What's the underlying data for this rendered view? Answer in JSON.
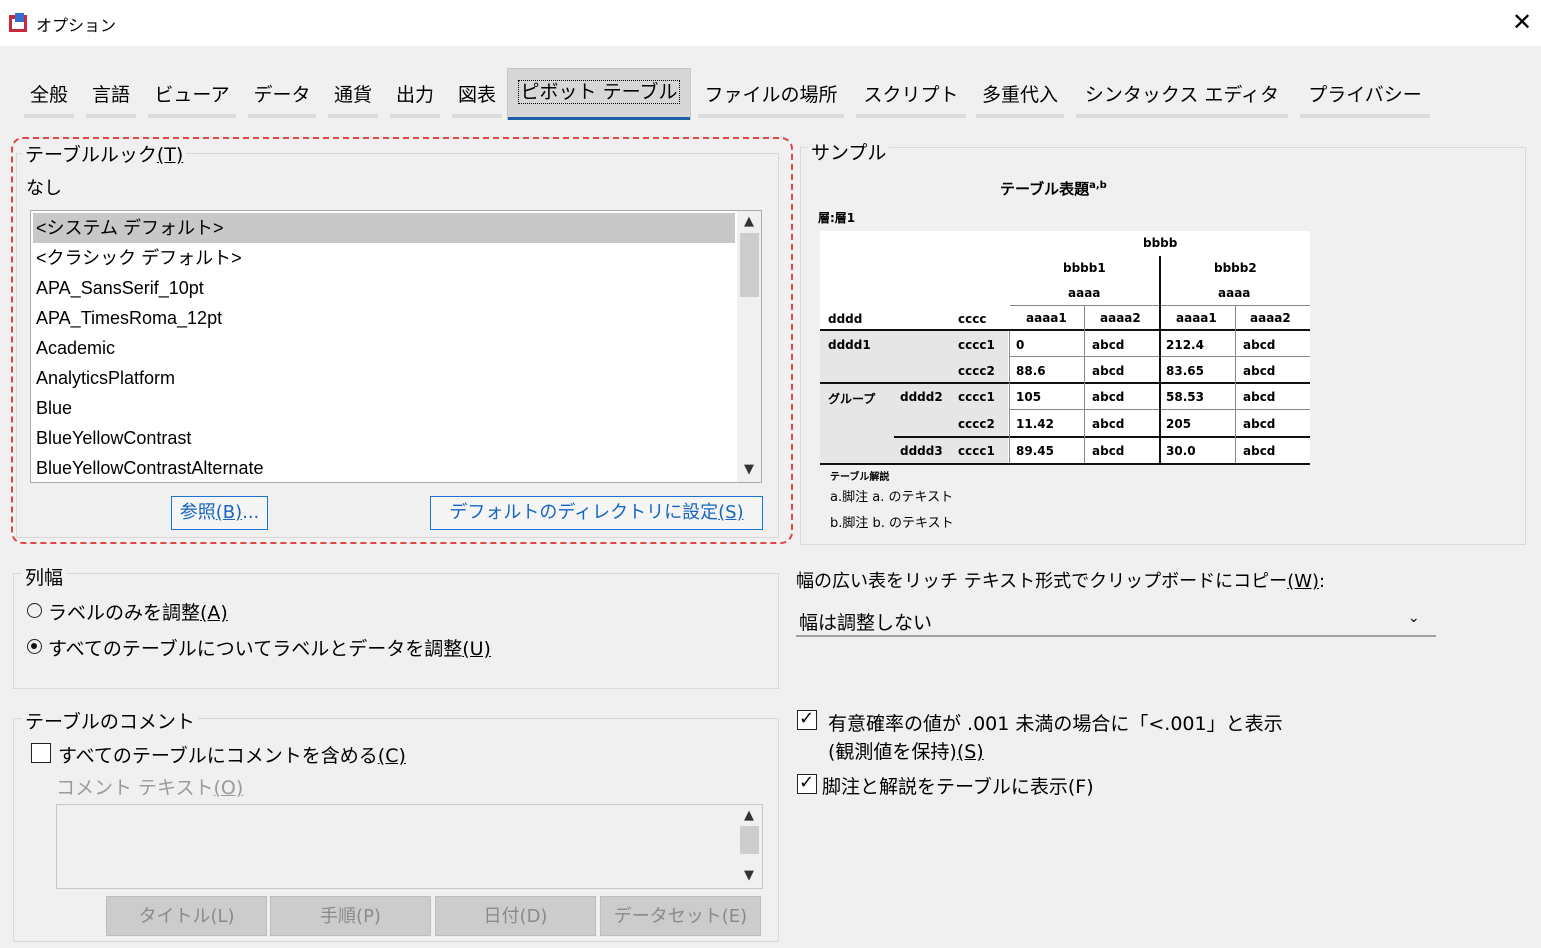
{
  "window": {
    "title": "オプション",
    "close_glyph": "✕"
  },
  "tabs": [
    {
      "label": "全般"
    },
    {
      "label": "言語"
    },
    {
      "label": "ビューア"
    },
    {
      "label": "データ"
    },
    {
      "label": "通貨"
    },
    {
      "label": "出力"
    },
    {
      "label": "図表"
    },
    {
      "label": "ピボット テーブル"
    },
    {
      "label": "ファイルの場所"
    },
    {
      "label": "スクリプト"
    },
    {
      "label": "多重代入"
    },
    {
      "label": "シンタックス エディタ"
    },
    {
      "label": "プライバシー"
    }
  ],
  "active_tab_index": 7,
  "table_looks": {
    "legend": "テーブルルック",
    "legend_key": "(T)",
    "current": "なし",
    "items": [
      "<システム デフォルト>",
      "<クラシック デフォルト>",
      "APA_SansSerif_10pt",
      "APA_TimesRoma_12pt",
      "Academic",
      "AnalyticsPlatform",
      "Blue",
      "BlueYellowContrast",
      "BlueYellowContrastAlternate"
    ],
    "selected_index": 0,
    "browse_button": "参照",
    "browse_key": "(B)",
    "browse_suffix": "...",
    "set_default_button": "デフォルトのディレクトリに設定",
    "set_default_key": "(S)"
  },
  "sample": {
    "legend": "サンプル",
    "table_title": "テーブル表題",
    "title_sup": "a,b",
    "layer": "層:層1",
    "col_top": "bbbb",
    "col_mid": [
      "bbbb1",
      "bbbb2"
    ],
    "col_sub": [
      "aaaa",
      "aaaa"
    ],
    "row_header_1": "dddd",
    "row_header_2": "cccc",
    "col_leaf": [
      "aaaa1",
      "aaaa2",
      "aaaa1",
      "aaaa2"
    ],
    "rows": [
      {
        "g": "",
        "d": "dddd1",
        "c": "cccc1",
        "v": [
          "0",
          "abcd",
          "212.4",
          "abcd"
        ]
      },
      {
        "g": "",
        "d": "",
        "c": "cccc2",
        "v": [
          "88.6",
          "abcd",
          "83.65",
          "abcd"
        ]
      },
      {
        "g": "グループ",
        "d": "dddd2",
        "c": "cccc1",
        "v": [
          "105",
          "abcd",
          "58.53",
          "abcd"
        ]
      },
      {
        "g": "",
        "d": "",
        "c": "cccc2",
        "v": [
          "11.42",
          "abcd",
          "205",
          "abcd"
        ]
      },
      {
        "g": "",
        "d": "dddd3",
        "c": "cccc1",
        "v": [
          "89.45",
          "abcd",
          "30.0",
          "abcd"
        ]
      }
    ],
    "caption": "テーブル解説",
    "footnote_a": "a.脚注 a. のテキスト",
    "footnote_b": "b.脚注 b. のテキスト"
  },
  "column_width": {
    "legend": "列幅",
    "option_labels_only": "ラベルのみを調整",
    "option_labels_only_key": "(A)",
    "option_all": "すべてのテーブルについてラベルとデータを調整",
    "option_all_key": "(U)",
    "selected": "all"
  },
  "clipboard": {
    "label": "幅の広い表をリッチ テキスト形式でクリップボードにコピー",
    "label_key": "(W)",
    "label_colon": ":",
    "value": "幅は調整しない"
  },
  "significance": {
    "label_line1": "有意確率の値が .001 未満の場合に「<.001」と表示",
    "label_line2": "(観測値を保持)",
    "label_key": "(S)",
    "checked": true
  },
  "footnotes_option": {
    "label": "脚注と解説をテーブルに表示(F)",
    "checked": true
  },
  "comment": {
    "legend": "テーブルのコメント",
    "include_label": "すべてのテーブルにコメントを含める",
    "include_key": "(C)",
    "include_checked": false,
    "text_label": "コメント テキスト",
    "text_key": "(O)",
    "buttons": [
      "タイトル(L)",
      "手順(P)",
      "日付(D)",
      "データセット(E)"
    ]
  }
}
